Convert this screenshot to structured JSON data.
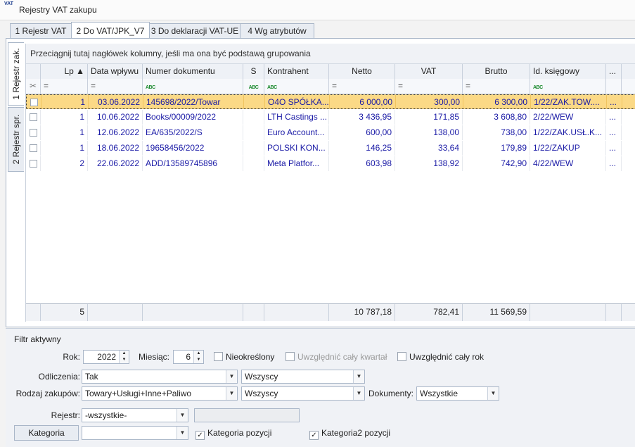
{
  "window": {
    "icon": "VAT",
    "title": "Rejestry VAT zakupu"
  },
  "tabs": [
    {
      "label": "1 Rejestr VAT"
    },
    {
      "label": "2 Do VAT/JPK_V7"
    },
    {
      "label": "3 Do deklaracji VAT-UE"
    },
    {
      "label": "4 Wg atrybutów"
    }
  ],
  "side_tabs": [
    {
      "label": "1 Rejestr zak."
    },
    {
      "label": "2 Rejestr spr."
    }
  ],
  "grid": {
    "group_hint": "Przeciągnij tutaj nagłówek kolumny, jeśli ma ona być podstawą grupowania",
    "columns": [
      "Lp ▲",
      "Data wpływu",
      "Numer dokumentu",
      "S",
      "Kontrahent",
      "Netto",
      "VAT",
      "Brutto",
      "Id. księgowy",
      "..."
    ],
    "filter_row": {
      "pin": "✂",
      "eq": "=",
      "abc": "ABC"
    },
    "rows": [
      {
        "lp": "1",
        "date": "03.06.2022",
        "doc": "145698/2022/Towar",
        "s": "",
        "contractor": "O4O SPÓŁKA...",
        "net": "6 000,00",
        "vat": "300,00",
        "gross": "6 300,00",
        "id": "1/22/ZAK.TOW....",
        "more": "..."
      },
      {
        "lp": "1",
        "date": "10.06.2022",
        "doc": "Books/00009/2022",
        "s": "",
        "contractor": "LTH Castings ...",
        "net": "3 436,95",
        "vat": "171,85",
        "gross": "3 608,80",
        "id": "2/22/WEW",
        "more": "..."
      },
      {
        "lp": "1",
        "date": "12.06.2022",
        "doc": "EA/635/2022/S",
        "s": "",
        "contractor": "Euro Account...",
        "net": "600,00",
        "vat": "138,00",
        "gross": "738,00",
        "id": "1/22/ZAK.USŁ.K...",
        "more": "..."
      },
      {
        "lp": "1",
        "date": "18.06.2022",
        "doc": "19658456/2022",
        "s": "",
        "contractor": "POLSKI KON...",
        "net": "146,25",
        "vat": "33,64",
        "gross": "179,89",
        "id": "1/22/ZAKUP",
        "more": "..."
      },
      {
        "lp": "2",
        "date": "22.06.2022",
        "doc": "ADD/13589745896",
        "s": "",
        "contractor": "Meta Platfor...",
        "net": "603,98",
        "vat": "138,92",
        "gross": "742,90",
        "id": "4/22/WEW",
        "more": "..."
      }
    ],
    "footer": {
      "count": "5",
      "net": "10 787,18",
      "vat": "782,41",
      "gross": "11 569,59"
    }
  },
  "filter": {
    "title": "Filtr aktywny",
    "rok_label": "Rok:",
    "rok_value": "2022",
    "miesiac_label": "Miesiąc:",
    "miesiac_value": "6",
    "nieokreslony": "Nieokreślony",
    "caly_kwartal": "Uwzględnić cały kwartał",
    "caly_rok": "Uwzględnić cały rok",
    "odliczenia_label": "Odliczenia:",
    "odliczenia_value": "Tak",
    "odliczenia_value2": "Wszyscy",
    "rodzaj_label": "Rodzaj zakupów:",
    "rodzaj_value": "Towary+Usługi+Inne+Paliwo",
    "rodzaj_value2": "Wszyscy",
    "dokumenty_label": "Dokumenty:",
    "dokumenty_value": "Wszystkie",
    "rejestr_label": "Rejestr:",
    "rejestr_value": "-wszystkie-",
    "kategoria_button": "Kategoria",
    "kategoria_pozycji": "Kategoria pozycji",
    "kategoria2_pozycji": "Kategoria2 pozycji",
    "check_mark": "✓",
    "dropdown_arrow": "▼"
  }
}
